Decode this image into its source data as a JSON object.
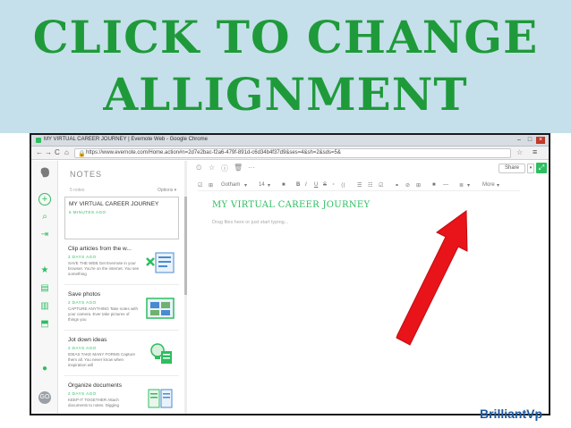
{
  "banner": {
    "line1": "CLICK TO CHANGE",
    "line2": "ALLIGNMENT"
  },
  "browser": {
    "tab_title": "MY VIRTUAL CAREER JOURNEY | Evernote Web - Google Chrome",
    "url": "https://www.evernote.com/Home.action#n=2d7e2bac-f2a6-479f-891d-c6d34b4f37d9&ses=4&sh=2&sds=5&",
    "icons": {
      "back": "←",
      "forward": "→",
      "reload": "C",
      "home": "⌂",
      "lock": "🔒",
      "star": "☆",
      "menu": "≡",
      "minimize": "–",
      "maximize": "□",
      "close": "×"
    }
  },
  "rail": {
    "icons": {
      "logo": "elephant-logo-icon",
      "new_note": "+",
      "search": "⌕",
      "shortcut": "⇥",
      "star": "★",
      "notes": "▤",
      "notebooks": "▥",
      "tags": "⬒",
      "tips": "●",
      "avatar": "GO"
    }
  },
  "notes_panel": {
    "heading": "NOTES",
    "count": "5 notes",
    "options": "Options ▾",
    "items": [
      {
        "title": "MY VIRTUAL CAREER JOURNEY",
        "date": "5 MINUTES AGO",
        "snippet": ""
      },
      {
        "title": "Clip articles from the w...",
        "date": "2 DAYS AGO",
        "snippet": "SAVE THE WEB Get Evernote in your browser. You're on the internet. You see something"
      },
      {
        "title": "Save photos",
        "date": "2 DAYS AGO",
        "snippet": "CAPTURE ANYTHING Take notes with your camera. Ever take pictures of things you"
      },
      {
        "title": "Jot down ideas",
        "date": "2 DAYS AGO",
        "snippet": "IDEAS TAKE MANY FORMS Capture them all. You never know when inspiration will"
      },
      {
        "title": "Organize documents",
        "date": "2 DAYS AGO",
        "snippet": "KEEP IT TOGETHER Attach documents to notes. Digging"
      }
    ]
  },
  "editor": {
    "top_icons": {
      "reminder": "⏲",
      "star": "☆",
      "info": "ⓘ",
      "trash": "🗑",
      "more": "···"
    },
    "share_label": "Share",
    "share_arrow": "▾",
    "expand_icon": "⤢",
    "format_bar": {
      "font": "Gotham",
      "size": "14",
      "color": "■",
      "bold": "B",
      "italic": "I",
      "underline": "U",
      "strike": "S",
      "super": "⁺",
      "code": "⟨⟩",
      "bullets": "☰",
      "numbers": "☷",
      "checkbox": "☑",
      "link": "⚭",
      "attach": "⊘",
      "table": "⊞",
      "hr": "―",
      "align": "≣",
      "more": "More"
    },
    "doc_title": "MY VIRTUAL CAREER JOURNEY",
    "hint": "Drag files here or just start typing..."
  },
  "brand": "BrilliantVp",
  "colors": {
    "banner_bg": "#c5e0ea",
    "banner_text": "#1f9a3a",
    "evernote_green": "#2dbe60",
    "arrow_red": "#e8141a",
    "brand_blue": "#1f5aa0"
  }
}
